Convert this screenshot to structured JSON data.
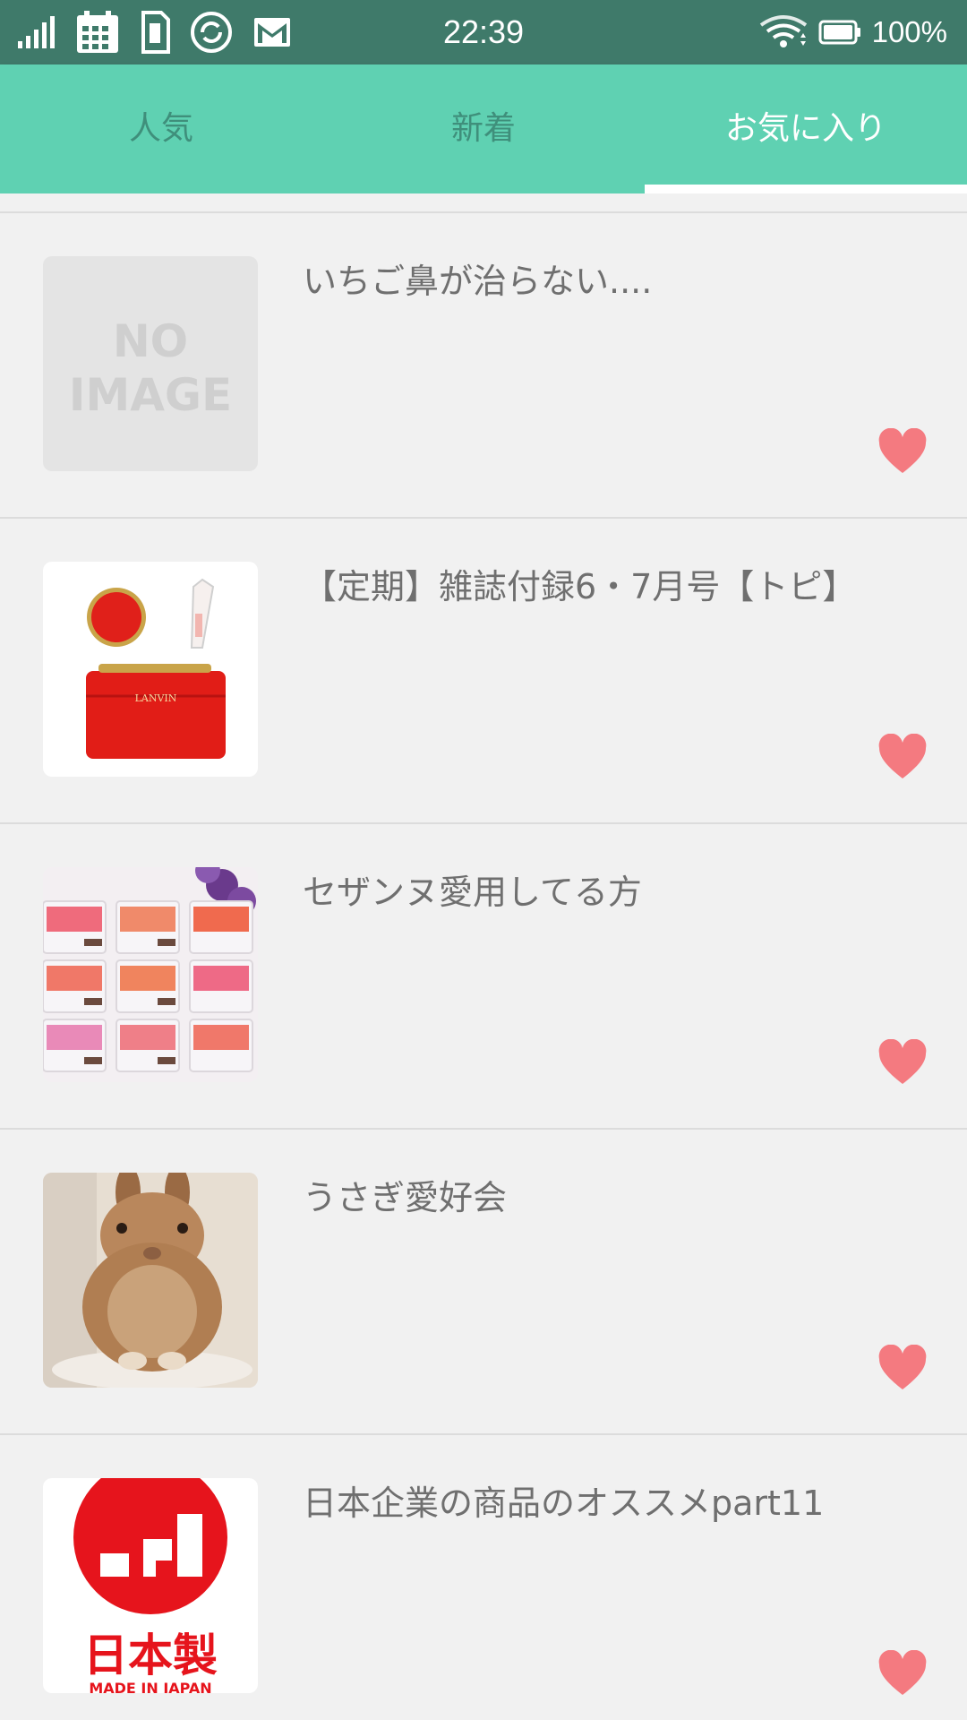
{
  "status_bar": {
    "time": "22:39",
    "battery": "100%",
    "icons": [
      "signal-icon",
      "calendar-icon",
      "sim-icon",
      "sync-icon",
      "gmail-icon",
      "wifi-icon",
      "battery-icon"
    ]
  },
  "tabs": [
    {
      "label": "人気",
      "active": false
    },
    {
      "label": "新着",
      "active": false
    },
    {
      "label": "お気に入り",
      "active": true
    }
  ],
  "colors": {
    "accent": "#5fd1b2",
    "status_bar": "#3f7a6a",
    "heart": "#f47a80"
  },
  "items": [
    {
      "title": "いちご鼻が治らない....",
      "thumb": "no-image",
      "no_image_text": [
        "NO",
        "IMAGE"
      ]
    },
    {
      "title": "【定期】雑誌付録6・7月号【トピ】",
      "thumb": "cosmetics-red-pouch",
      "brand_text": "LANVIN"
    },
    {
      "title": "セザンヌ愛用してる方",
      "thumb": "blush-palettes"
    },
    {
      "title": "うさぎ愛好会",
      "thumb": "rabbit-photo"
    },
    {
      "title": "日本企業の商品のオススメpart11",
      "thumb": "made-in-japan-logo",
      "logo_text": [
        "日本製",
        "MADE IN JAPAN"
      ]
    }
  ]
}
